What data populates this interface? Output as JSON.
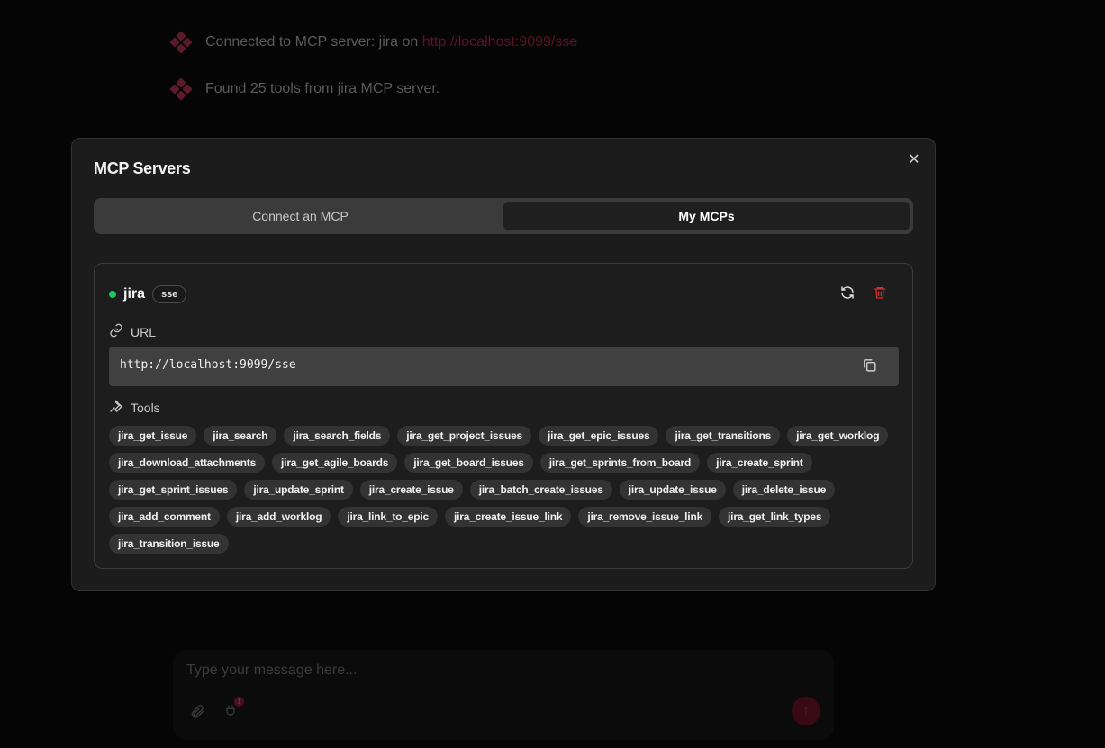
{
  "background": {
    "messages": [
      {
        "prefix": "Connected to MCP server: jira on ",
        "link": "http://localhost:9099/sse"
      },
      {
        "prefix": "Found 25 tools from jira MCP server.",
        "link": ""
      }
    ],
    "composer": {
      "placeholder": "Type your message here...",
      "badge_count": "1"
    }
  },
  "modal": {
    "title": "MCP Servers",
    "tabs": [
      {
        "label": "Connect an MCP",
        "active": false
      },
      {
        "label": "My MCPs",
        "active": true
      }
    ],
    "server": {
      "name": "jira",
      "transport": "sse",
      "status_color": "#22c55e",
      "url_label": "URL",
      "url": "http://localhost:9099/sse",
      "tools_label": "Tools",
      "tools": [
        "jira_get_issue",
        "jira_search",
        "jira_search_fields",
        "jira_get_project_issues",
        "jira_get_epic_issues",
        "jira_get_transitions",
        "jira_get_worklog",
        "jira_download_attachments",
        "jira_get_agile_boards",
        "jira_get_board_issues",
        "jira_get_sprints_from_board",
        "jira_create_sprint",
        "jira_get_sprint_issues",
        "jira_update_sprint",
        "jira_create_issue",
        "jira_batch_create_issues",
        "jira_update_issue",
        "jira_delete_issue",
        "jira_add_comment",
        "jira_add_worklog",
        "jira_link_to_epic",
        "jira_create_issue_link",
        "jira_remove_issue_link",
        "jira_get_link_types",
        "jira_transition_issue"
      ]
    }
  },
  "colors": {
    "accent": "#c8102e",
    "delete": "#c53030",
    "status": "#22c55e"
  }
}
